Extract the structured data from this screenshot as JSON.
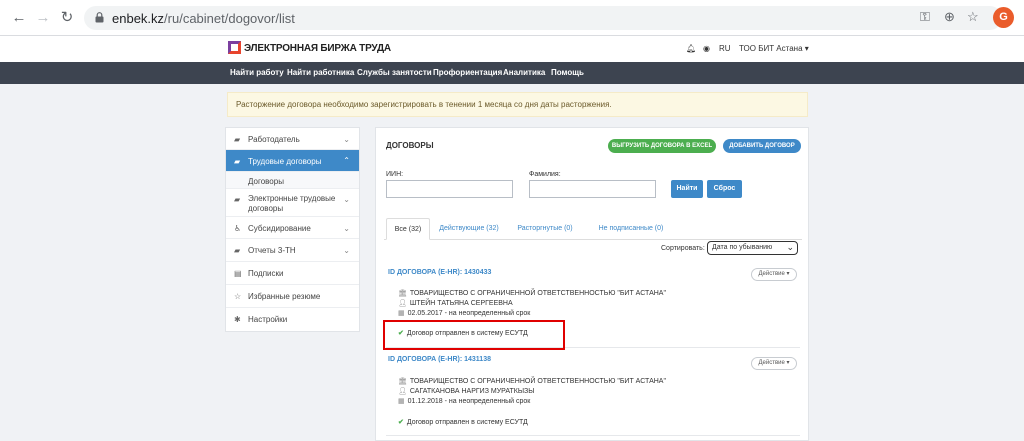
{
  "browser": {
    "url_main": "enbek.kz",
    "url_path": "/ru/cabinet/dogovor/list",
    "profile_initial": "G"
  },
  "header": {
    "logo_text": "ЭЛЕКТРОННАЯ БИРЖА ТРУДА",
    "language": "RU",
    "company": "ТОО БИТ Астана"
  },
  "topnav": [
    "Найти работу",
    "Найти работника",
    "Службы занятости",
    "Профориентация",
    "Аналитика",
    "Помощь"
  ],
  "notice": "Расторжение договора необходимо зарегистрировать в тенении 1 месяца со дня даты расторжения.",
  "sidebar": {
    "items": [
      {
        "label": "Работодатель",
        "icon": "briefcase-icon"
      },
      {
        "label": "Трудовые договоры",
        "icon": "briefcase-icon"
      },
      {
        "label": "Договоры"
      },
      {
        "label": "Электронные трудовые договоры",
        "line1": "Электронные трудовые",
        "line2": "договоры",
        "icon": "briefcase-icon"
      },
      {
        "label": "Субсидирование",
        "icon": "accessibility-icon"
      },
      {
        "label": "Отчеты 3-ТН",
        "icon": "briefcase-icon"
      },
      {
        "label": "Подписки",
        "icon": "list-icon"
      },
      {
        "label": "Избранные резюме",
        "icon": "star-icon"
      },
      {
        "label": "Настройки",
        "icon": "gear-icon"
      }
    ]
  },
  "main": {
    "title": "ДОГОВОРЫ",
    "export_button": "ВЫГРУЗИТЬ ДОГОВОРА В EXCEL",
    "add_button": "ДОБАВИТЬ ДОГОВОР",
    "iin_label": "ИИН:",
    "surname_label": "Фамилия:",
    "find_button": "Найти",
    "reset_button": "Сброс",
    "tabs": [
      "Все (32)",
      "Действующие (32)",
      "Расторгнутые (0)",
      "Не подписанные (0)"
    ],
    "sort_label": "Сортировать:",
    "sort_value": "Дата по убыванию",
    "contracts": [
      {
        "id": "ID ДОГОВОРА (Е-HR): 1430433",
        "actions": "Действие",
        "company": "ТОВАРИЩЕСТВО С ОГРАНИЧЕННОЙ ОТВЕТСТВЕННОСТЬЮ \"БИТ АСТАНА\"",
        "person": "ШТЕЙН ТАТЬЯНА СЕРГЕЕВНА",
        "date": "02.05.2017 - на неопределенный срок",
        "status": "Договор отправлен в систему ЕСУТД"
      },
      {
        "id": "ID ДОГОВОРА (Е-HR): 1431138",
        "actions": "Действие",
        "company": "ТОВАРИЩЕСТВО С ОГРАНИЧЕННОЙ ОТВЕТСТВЕННОСТЬЮ \"БИТ АСТАНА\"",
        "person": "САГАТКАНОВА НАРГИЗ МУРАТКЫЗЫ",
        "date": "01.12.2018 - на неопределенный срок",
        "status": "Договор отправлен в систему ЕСУТД"
      }
    ]
  },
  "colors": {
    "accent": "#3e89c8",
    "success": "#4cae4f",
    "nav_bg": "#3d4450",
    "highlight": "#e00000"
  }
}
